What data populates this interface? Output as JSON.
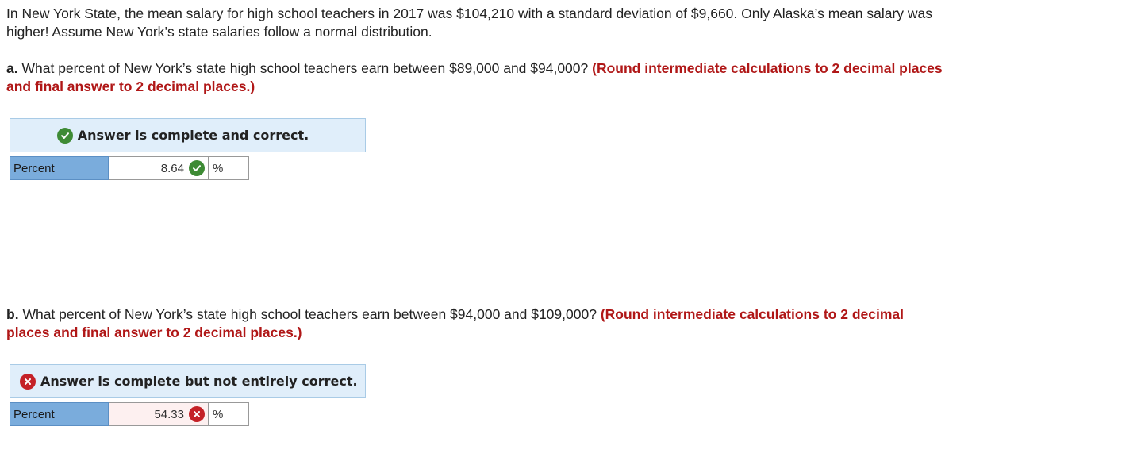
{
  "intro": "In New York State, the mean salary for high school teachers in 2017 was $104,210 with a standard deviation of $9,660. Only Alaska’s mean salary was higher! Assume New York’s state salaries follow a normal distribution.",
  "parts": [
    {
      "letter": "a.",
      "question": "What percent of New York’s state high school teachers earn between $89,000 and $94,000?",
      "instruction": "(Round intermediate calculations to 2 decimal places and final answer to 2 decimal places.)",
      "status": "Answer is complete and correct.",
      "status_icon": "check-circle-icon",
      "row_label": "Percent",
      "value": "8.64",
      "unit": "%",
      "correct": true
    },
    {
      "letter": "b.",
      "question": "What percent of New York’s state high school teachers earn between $94,000 and $109,000?",
      "instruction": "(Round intermediate calculations to 2 decimal places and final answer to 2 decimal places.)",
      "status": "Answer is complete but not entirely correct.",
      "status_icon": "x-circle-icon",
      "row_label": "Percent",
      "value": "54.33",
      "unit": "%",
      "correct": false
    }
  ],
  "colors": {
    "instruction_red": "#b01717",
    "correct_green": "#3e8b35",
    "incorrect_red": "#c42127",
    "status_bg": "#e0eefa",
    "label_bg": "#7aacdc"
  }
}
